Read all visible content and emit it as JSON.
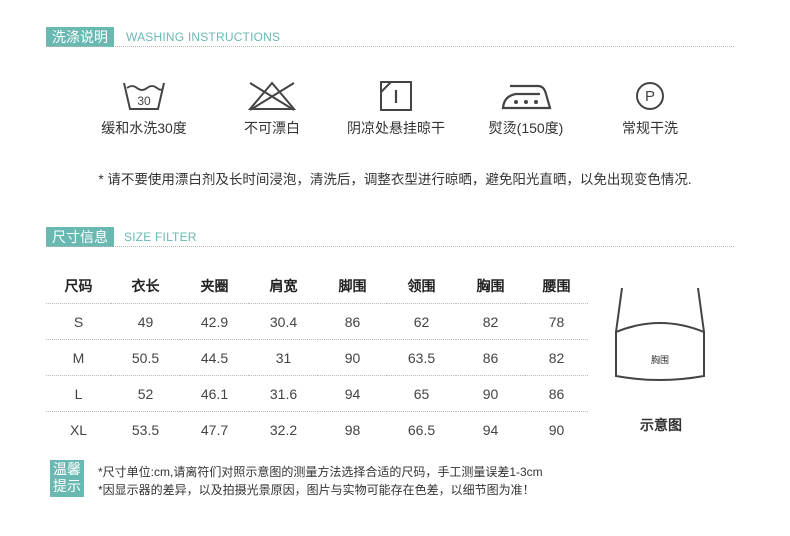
{
  "washing": {
    "title_cn": "洗涤说明",
    "title_en": "WASHING INSTRUCTIONS",
    "items": [
      {
        "icon": "wash-30-icon",
        "label": "缓和水洗30度",
        "icon_text": "30"
      },
      {
        "icon": "no-bleach-icon",
        "label": "不可漂白"
      },
      {
        "icon": "hang-dry-shade-icon",
        "label": "阴凉处悬挂晾干"
      },
      {
        "icon": "iron-icon",
        "label": "熨烫(150度)"
      },
      {
        "icon": "dry-clean-icon",
        "label": "常规干洗",
        "icon_text": "P"
      }
    ],
    "note": "* 请不要使用漂白剂及长时间浸泡，清洗后，调整衣型进行晾晒，避免阳光直晒，以免出现变色情况."
  },
  "size": {
    "title_cn": "尺寸信息",
    "title_en": "SIZE FILTER",
    "headers": [
      "尺码",
      "衣长",
      "夹圈",
      "肩宽",
      "脚围",
      "领围",
      "胸围",
      "腰围"
    ],
    "rows": [
      [
        "S",
        "49",
        "42.9",
        "30.4",
        "86",
        "62",
        "82",
        "78"
      ],
      [
        "M",
        "50.5",
        "44.5",
        "31",
        "90",
        "63.5",
        "86",
        "82"
      ],
      [
        "L",
        "52",
        "46.1",
        "31.6",
        "94",
        "65",
        "90",
        "86"
      ],
      [
        "XL",
        "53.5",
        "47.7",
        "32.2",
        "98",
        "66.5",
        "94",
        "90"
      ]
    ],
    "diagram_inner_label": "胸围",
    "diagram_caption": "示意图"
  },
  "tips": {
    "label_line1": "温馨",
    "label_line2": "提示",
    "lines": [
      "*尺寸单位:cm,请离符们对照示意图的测量方法选择合适的尺码，手工测量误差1-3cm",
      "*因显示器的差异，以及拍摄光景原因，图片与实物可能存在色差，以细节图为准！"
    ]
  },
  "colors": {
    "accent": "#6ab8b2",
    "text": "#333333",
    "divider": "#b8b8b8"
  }
}
